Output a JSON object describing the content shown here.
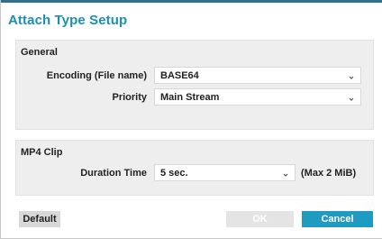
{
  "dialog": {
    "title": "Attach Type Setup"
  },
  "general": {
    "title": "General",
    "encoding": {
      "label": "Encoding (File name)",
      "value": "BASE64",
      "icon": "chevron-down-icon"
    },
    "priority": {
      "label": "Priority",
      "value": "Main Stream",
      "icon": "chevron-down-icon"
    }
  },
  "mp4_clip": {
    "title": "MP4 Clip",
    "duration": {
      "label": "Duration Time",
      "value": "5 sec.",
      "note": "(Max 2 MiB)",
      "icon": "chevron-down-icon"
    }
  },
  "buttons": {
    "default_label": "Default",
    "ok_label": "OK",
    "cancel_label": "Cancel"
  },
  "colors": {
    "accent": "#1f9ac0",
    "title": "#1b8fb5",
    "panel": "#eeeeee",
    "disabled": "#e4e4e4"
  }
}
